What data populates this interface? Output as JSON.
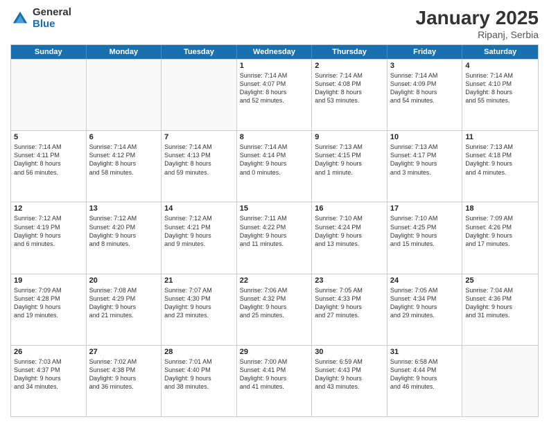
{
  "logo": {
    "general": "General",
    "blue": "Blue"
  },
  "title": {
    "month": "January 2025",
    "location": "Ripanj, Serbia"
  },
  "header_days": [
    "Sunday",
    "Monday",
    "Tuesday",
    "Wednesday",
    "Thursday",
    "Friday",
    "Saturday"
  ],
  "rows": [
    [
      {
        "day": "",
        "info": "",
        "empty": true
      },
      {
        "day": "",
        "info": "",
        "empty": true
      },
      {
        "day": "",
        "info": "",
        "empty": true
      },
      {
        "day": "1",
        "info": "Sunrise: 7:14 AM\nSunset: 4:07 PM\nDaylight: 8 hours\nand 52 minutes.",
        "empty": false
      },
      {
        "day": "2",
        "info": "Sunrise: 7:14 AM\nSunset: 4:08 PM\nDaylight: 8 hours\nand 53 minutes.",
        "empty": false
      },
      {
        "day": "3",
        "info": "Sunrise: 7:14 AM\nSunset: 4:09 PM\nDaylight: 8 hours\nand 54 minutes.",
        "empty": false
      },
      {
        "day": "4",
        "info": "Sunrise: 7:14 AM\nSunset: 4:10 PM\nDaylight: 8 hours\nand 55 minutes.",
        "empty": false
      }
    ],
    [
      {
        "day": "5",
        "info": "Sunrise: 7:14 AM\nSunset: 4:11 PM\nDaylight: 8 hours\nand 56 minutes.",
        "empty": false
      },
      {
        "day": "6",
        "info": "Sunrise: 7:14 AM\nSunset: 4:12 PM\nDaylight: 8 hours\nand 58 minutes.",
        "empty": false
      },
      {
        "day": "7",
        "info": "Sunrise: 7:14 AM\nSunset: 4:13 PM\nDaylight: 8 hours\nand 59 minutes.",
        "empty": false
      },
      {
        "day": "8",
        "info": "Sunrise: 7:14 AM\nSunset: 4:14 PM\nDaylight: 9 hours\nand 0 minutes.",
        "empty": false
      },
      {
        "day": "9",
        "info": "Sunrise: 7:13 AM\nSunset: 4:15 PM\nDaylight: 9 hours\nand 1 minute.",
        "empty": false
      },
      {
        "day": "10",
        "info": "Sunrise: 7:13 AM\nSunset: 4:17 PM\nDaylight: 9 hours\nand 3 minutes.",
        "empty": false
      },
      {
        "day": "11",
        "info": "Sunrise: 7:13 AM\nSunset: 4:18 PM\nDaylight: 9 hours\nand 4 minutes.",
        "empty": false
      }
    ],
    [
      {
        "day": "12",
        "info": "Sunrise: 7:12 AM\nSunset: 4:19 PM\nDaylight: 9 hours\nand 6 minutes.",
        "empty": false
      },
      {
        "day": "13",
        "info": "Sunrise: 7:12 AM\nSunset: 4:20 PM\nDaylight: 9 hours\nand 8 minutes.",
        "empty": false
      },
      {
        "day": "14",
        "info": "Sunrise: 7:12 AM\nSunset: 4:21 PM\nDaylight: 9 hours\nand 9 minutes.",
        "empty": false
      },
      {
        "day": "15",
        "info": "Sunrise: 7:11 AM\nSunset: 4:22 PM\nDaylight: 9 hours\nand 11 minutes.",
        "empty": false
      },
      {
        "day": "16",
        "info": "Sunrise: 7:10 AM\nSunset: 4:24 PM\nDaylight: 9 hours\nand 13 minutes.",
        "empty": false
      },
      {
        "day": "17",
        "info": "Sunrise: 7:10 AM\nSunset: 4:25 PM\nDaylight: 9 hours\nand 15 minutes.",
        "empty": false
      },
      {
        "day": "18",
        "info": "Sunrise: 7:09 AM\nSunset: 4:26 PM\nDaylight: 9 hours\nand 17 minutes.",
        "empty": false
      }
    ],
    [
      {
        "day": "19",
        "info": "Sunrise: 7:09 AM\nSunset: 4:28 PM\nDaylight: 9 hours\nand 19 minutes.",
        "empty": false
      },
      {
        "day": "20",
        "info": "Sunrise: 7:08 AM\nSunset: 4:29 PM\nDaylight: 9 hours\nand 21 minutes.",
        "empty": false
      },
      {
        "day": "21",
        "info": "Sunrise: 7:07 AM\nSunset: 4:30 PM\nDaylight: 9 hours\nand 23 minutes.",
        "empty": false
      },
      {
        "day": "22",
        "info": "Sunrise: 7:06 AM\nSunset: 4:32 PM\nDaylight: 9 hours\nand 25 minutes.",
        "empty": false
      },
      {
        "day": "23",
        "info": "Sunrise: 7:05 AM\nSunset: 4:33 PM\nDaylight: 9 hours\nand 27 minutes.",
        "empty": false
      },
      {
        "day": "24",
        "info": "Sunrise: 7:05 AM\nSunset: 4:34 PM\nDaylight: 9 hours\nand 29 minutes.",
        "empty": false
      },
      {
        "day": "25",
        "info": "Sunrise: 7:04 AM\nSunset: 4:36 PM\nDaylight: 9 hours\nand 31 minutes.",
        "empty": false
      }
    ],
    [
      {
        "day": "26",
        "info": "Sunrise: 7:03 AM\nSunset: 4:37 PM\nDaylight: 9 hours\nand 34 minutes.",
        "empty": false
      },
      {
        "day": "27",
        "info": "Sunrise: 7:02 AM\nSunset: 4:38 PM\nDaylight: 9 hours\nand 36 minutes.",
        "empty": false
      },
      {
        "day": "28",
        "info": "Sunrise: 7:01 AM\nSunset: 4:40 PM\nDaylight: 9 hours\nand 38 minutes.",
        "empty": false
      },
      {
        "day": "29",
        "info": "Sunrise: 7:00 AM\nSunset: 4:41 PM\nDaylight: 9 hours\nand 41 minutes.",
        "empty": false
      },
      {
        "day": "30",
        "info": "Sunrise: 6:59 AM\nSunset: 4:43 PM\nDaylight: 9 hours\nand 43 minutes.",
        "empty": false
      },
      {
        "day": "31",
        "info": "Sunrise: 6:58 AM\nSunset: 4:44 PM\nDaylight: 9 hours\nand 46 minutes.",
        "empty": false
      },
      {
        "day": "",
        "info": "",
        "empty": true
      }
    ]
  ]
}
